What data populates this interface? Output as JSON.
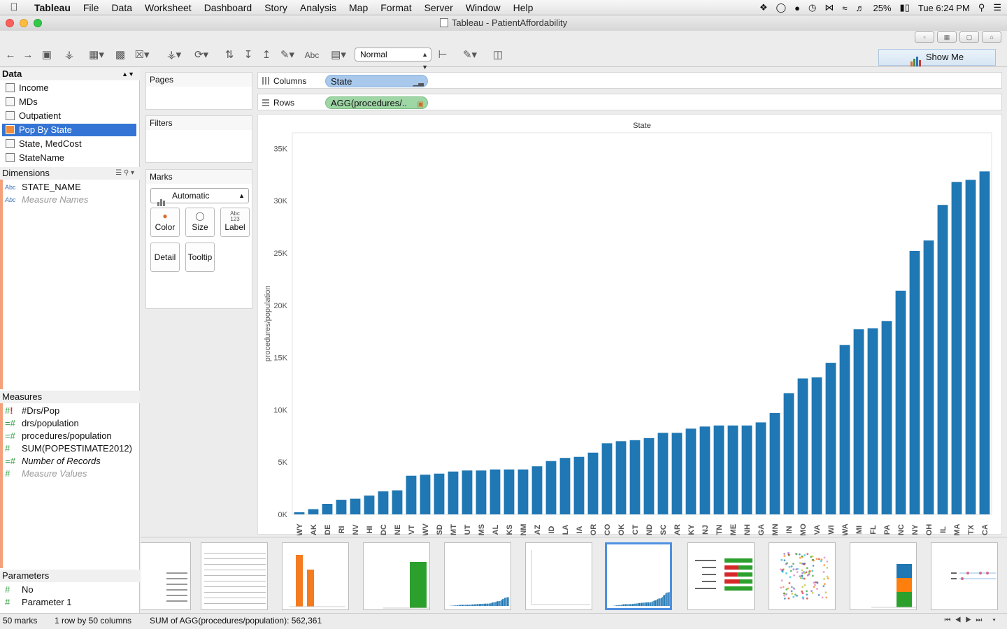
{
  "menubar": {
    "app": "Tableau",
    "items": [
      "File",
      "Data",
      "Worksheet",
      "Dashboard",
      "Story",
      "Analysis",
      "Map",
      "Format",
      "Server",
      "Window",
      "Help"
    ],
    "battery": "25%",
    "clock": "Tue 6:24 PM"
  },
  "window": {
    "title": "Tableau - PatientAffordability"
  },
  "toolbar": {
    "fit": "Normal",
    "abc": "Abc",
    "show_me": "Show Me"
  },
  "data_pane": {
    "header": "Data",
    "sources": [
      "Income",
      "MDs",
      "Outpatient",
      "Pop By State",
      "State, MedCost",
      "StateName"
    ],
    "selected_source": "Pop By State",
    "dimensions_header": "Dimensions",
    "dimensions": [
      "STATE_NAME",
      "Measure Names"
    ],
    "dimension_type": "Abc",
    "measures_header": "Measures",
    "measures": [
      "#Drs/Pop",
      "drs/population",
      "procedures/population",
      "SUM(POPESTIMATE2012)",
      "Number of Records",
      "Measure Values"
    ],
    "parameters_header": "Parameters",
    "parameters": [
      "No",
      "Parameter 1"
    ]
  },
  "cards": {
    "pages": "Pages",
    "filters": "Filters",
    "marks": "Marks",
    "mark_type": "Automatic",
    "buttons": [
      "Color",
      "Size",
      "Label",
      "Detail",
      "Tooltip"
    ]
  },
  "shelves": {
    "columns_label": "Columns",
    "columns_pill": "State",
    "rows_label": "Rows",
    "rows_pill": "AGG(procedures/.."
  },
  "chart_data": {
    "type": "bar",
    "title": "State",
    "ylabel": "procedures/population",
    "ylim": [
      0,
      36500
    ],
    "yticks": [
      0,
      5000,
      10000,
      15000,
      20000,
      25000,
      30000,
      35000
    ],
    "ytick_labels": [
      "0K",
      "5K",
      "10K",
      "15K",
      "20K",
      "25K",
      "30K",
      "35K"
    ],
    "categories": [
      "WY",
      "AK",
      "DE",
      "RI",
      "NV",
      "HI",
      "DC",
      "NE",
      "VT",
      "WV",
      "SD",
      "MT",
      "UT",
      "MS",
      "AL",
      "KS",
      "NM",
      "AZ",
      "ID",
      "LA",
      "IA",
      "OR",
      "CO",
      "OK",
      "CT",
      "ND",
      "SC",
      "AR",
      "KY",
      "NJ",
      "TN",
      "ME",
      "NH",
      "GA",
      "MN",
      "IN",
      "MO",
      "VA",
      "WI",
      "WA",
      "MI",
      "FL",
      "PA",
      "NC",
      "NY",
      "OH",
      "IL",
      "MA",
      "TX",
      "CA"
    ],
    "values": [
      200,
      500,
      1000,
      1400,
      1500,
      1800,
      2200,
      2300,
      3700,
      3800,
      3900,
      4100,
      4200,
      4200,
      4300,
      4300,
      4300,
      4600,
      5100,
      5400,
      5500,
      5900,
      6800,
      7000,
      7100,
      7300,
      7800,
      7800,
      8200,
      8400,
      8500,
      8500,
      8500,
      8800,
      9700,
      11600,
      13000,
      13100,
      14500,
      16200,
      17700,
      17800,
      18500,
      21400,
      25200,
      26200,
      29600,
      31800,
      32000,
      32800
    ],
    "bar_color": "#1f77b4"
  },
  "status": {
    "marks": "50 marks",
    "dims": "1 row by 50 columns",
    "sum": "SUM of AGG(procedures/population): 562,361"
  },
  "icons": [
    "apple-icon",
    "dropbox-icon",
    "bluetooth-icon",
    "wifi-icon",
    "volume-icon",
    "battery-icon",
    "search-icon",
    "list-icon",
    "back-icon",
    "forward-icon",
    "save-icon",
    "datasource-icon",
    "refresh-icon",
    "swap-icon",
    "sort-asc-icon",
    "sort-desc-icon",
    "highlight-icon",
    "label-icon",
    "chart-size-icon",
    "pin-icon",
    "pen-icon",
    "presentation-icon"
  ]
}
